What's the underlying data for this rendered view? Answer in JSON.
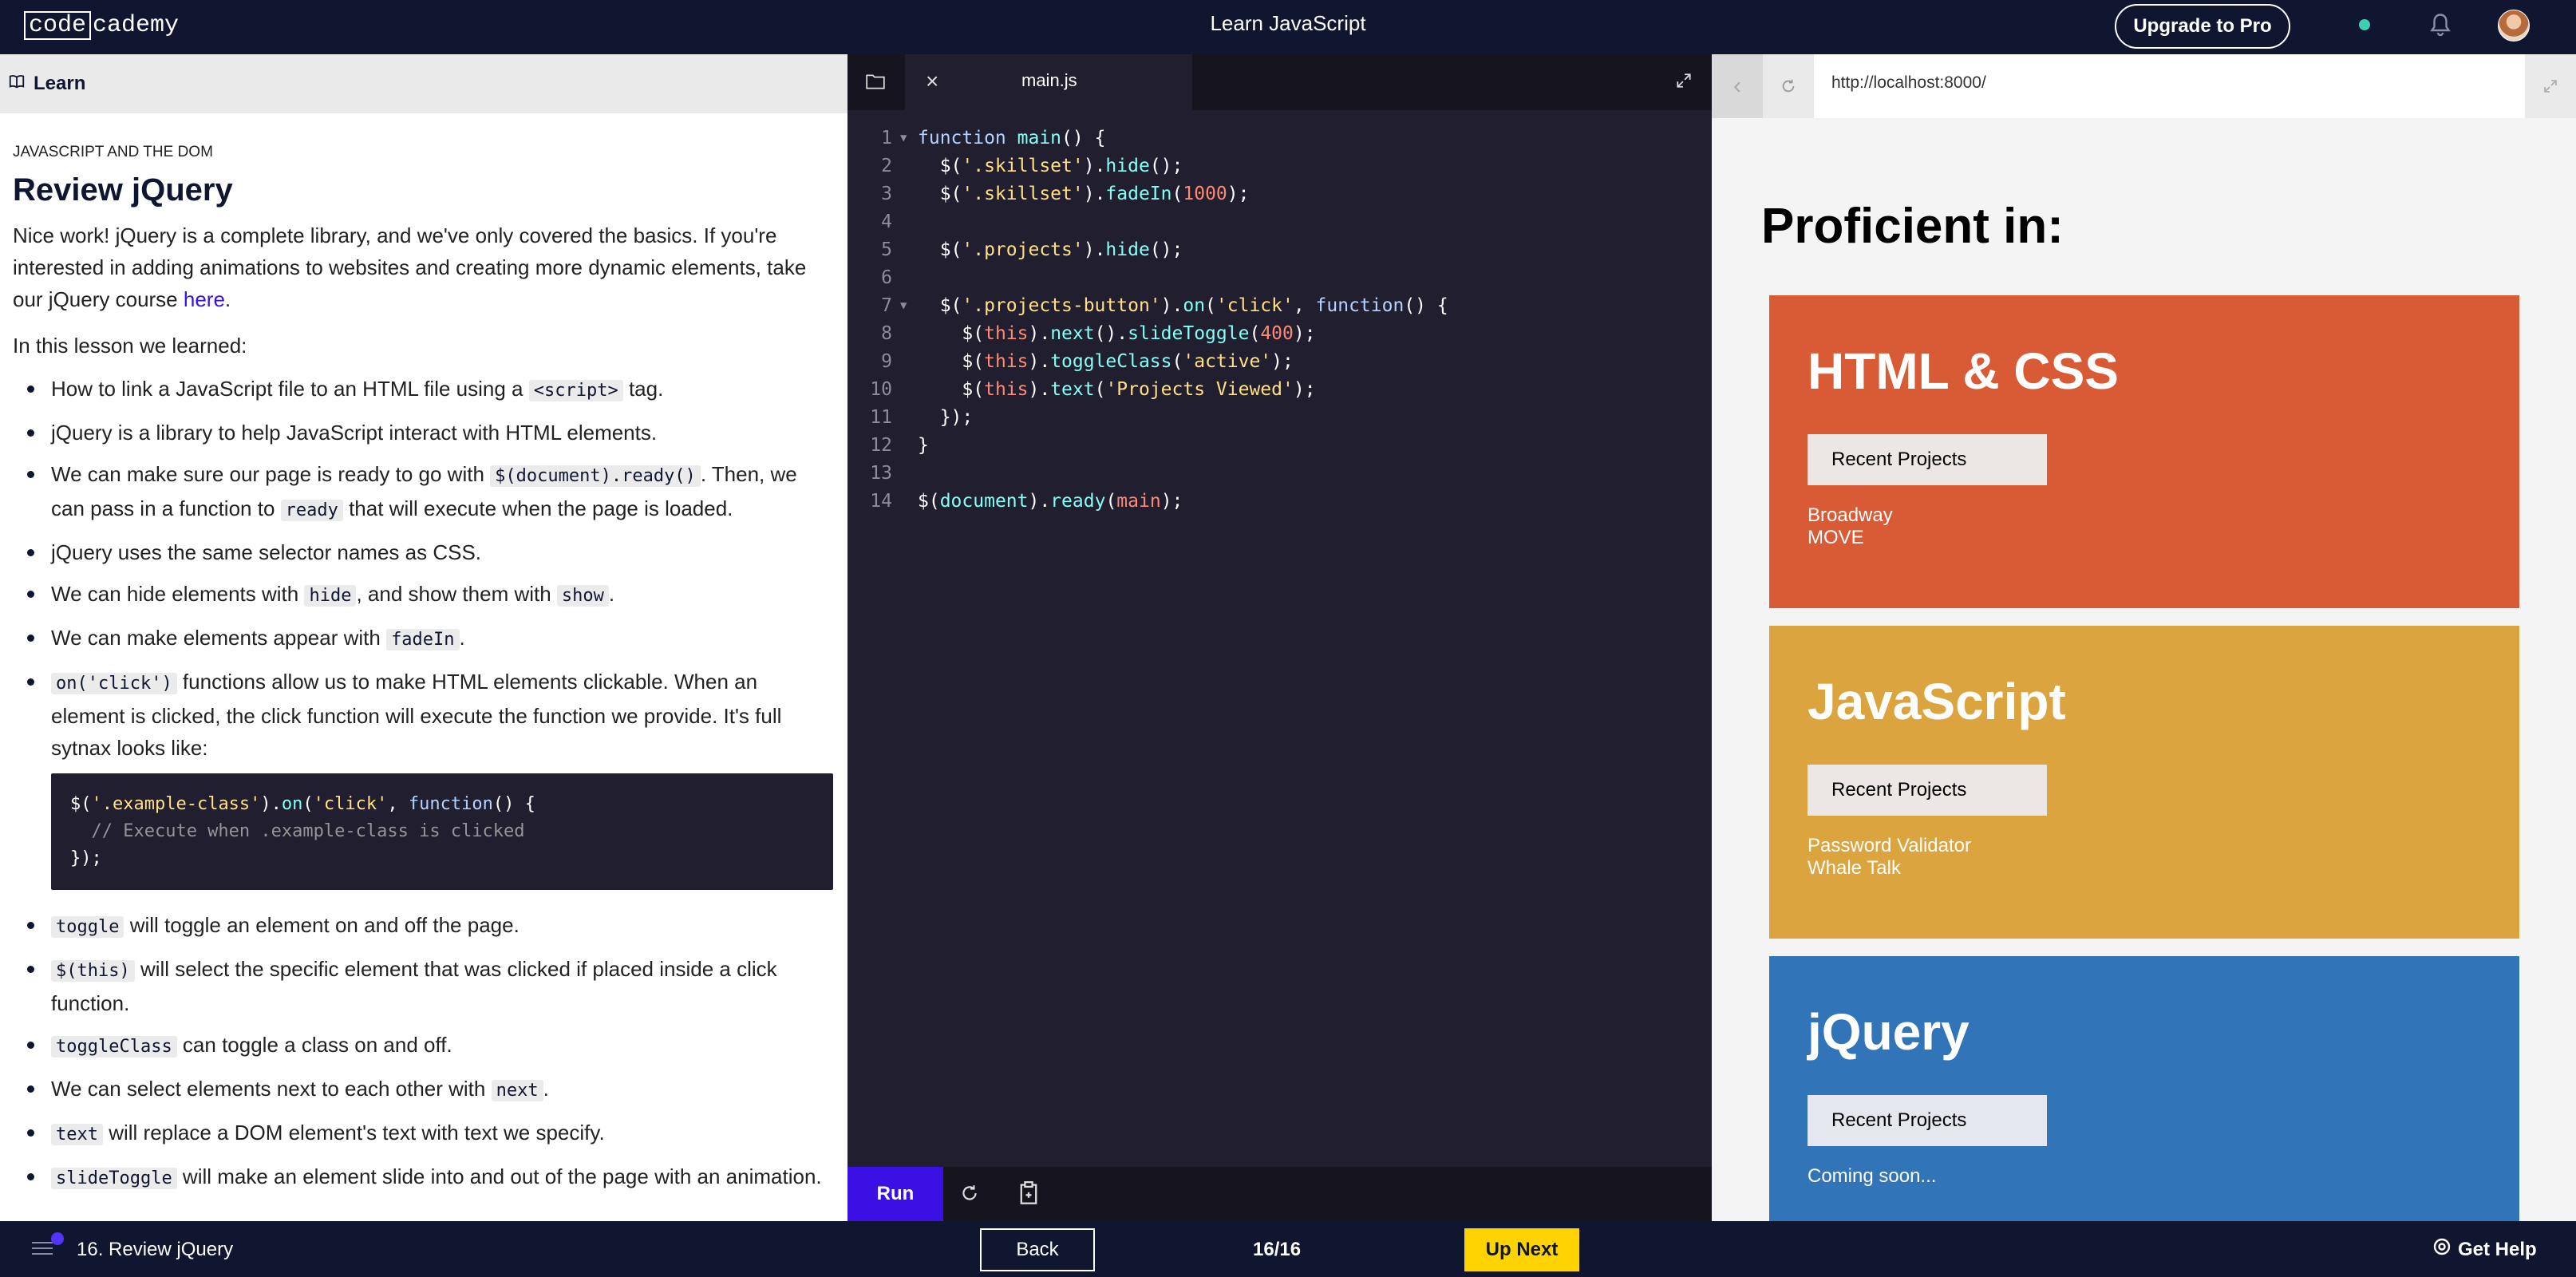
{
  "topbar": {
    "logo_box": "code",
    "logo_rest": "cademy",
    "title": "Learn JavaScript",
    "upgrade_label": "Upgrade to Pro",
    "status_color": "#3ecfb2"
  },
  "learn": {
    "header_label": "Learn",
    "overline": "JAVASCRIPT AND THE DOM",
    "title": "Review jQuery",
    "intro_1": "Nice work! jQuery is a complete library, and we've only covered the basics. If you're interested in adding animations to websites and creating more dynamic elements, take our jQuery course ",
    "intro_link": "here",
    "intro_end": ".",
    "learned": "In this lesson we learned:",
    "bullets": [
      {
        "pre": "How to link a JavaScript file to an HTML file using a ",
        "code": "<script>",
        "post": " tag."
      },
      {
        "pre": "jQuery is a library to help JavaScript interact with HTML elements.",
        "code": "",
        "post": ""
      },
      {
        "pre": "We can make sure our page is ready to go with ",
        "code": "$(document).ready()",
        "post": ". Then, we can pass in a function to ",
        "code2": "ready",
        "post2": " that will execute when the page is loaded."
      },
      {
        "pre": "jQuery uses the same selector names as CSS.",
        "code": "",
        "post": ""
      },
      {
        "pre": "We can hide elements with ",
        "code": "hide",
        "post": ", and show them with ",
        "code2": "show",
        "post2": "."
      },
      {
        "pre": "We can make elements appear with ",
        "code": "fadeIn",
        "post": "."
      },
      {
        "pre": "",
        "code": "on('click')",
        "post": " functions allow us to make HTML elements clickable. When an element is clicked, the click function will execute the function we provide. It's full sytnax looks like:"
      },
      {
        "pre": "",
        "code": "toggle",
        "post": " will toggle an element on and off the page."
      },
      {
        "pre": "",
        "code": "$(this)",
        "post": " will select the specific element that was clicked if placed inside a click function."
      },
      {
        "pre": "",
        "code": "toggleClass",
        "post": " can toggle a class on and off."
      },
      {
        "pre": "We can select elements next to each other with ",
        "code": "next",
        "post": "."
      },
      {
        "pre": "",
        "code": "text",
        "post": " will replace a DOM element's text with text we specify."
      },
      {
        "pre": "",
        "code": "slideToggle",
        "post": " will make an element slide into and out of the page with an animation."
      }
    ],
    "example_code": {
      "l1_a": "$(",
      "l1_b": "'.example-class'",
      "l1_c": ").",
      "l1_d": "on",
      "l1_e": "(",
      "l1_f": "'click'",
      "l1_g": ", ",
      "l1_h": "function",
      "l1_i": "() {",
      "l2": "  // Execute when .example-class is clicked",
      "l3": "});"
    }
  },
  "editor": {
    "tab_name": "main.js",
    "lines": [
      {
        "n": "1",
        "fold": true
      },
      {
        "n": "2",
        "fold": false
      },
      {
        "n": "3",
        "fold": false
      },
      {
        "n": "4",
        "fold": false
      },
      {
        "n": "5",
        "fold": false
      },
      {
        "n": "6",
        "fold": false
      },
      {
        "n": "7",
        "fold": true
      },
      {
        "n": "8",
        "fold": false
      },
      {
        "n": "9",
        "fold": false
      },
      {
        "n": "10",
        "fold": false
      },
      {
        "n": "11",
        "fold": false
      },
      {
        "n": "12",
        "fold": false
      },
      {
        "n": "13",
        "fold": false
      },
      {
        "n": "14",
        "fold": false
      }
    ],
    "run_label": "Run"
  },
  "browser": {
    "url": "http://localhost:8000/",
    "heading": "Proficient in:",
    "skills": [
      {
        "title": "HTML & CSS",
        "button": "Recent Projects",
        "projects": [
          "Broadway",
          "MOVE"
        ],
        "color": "#d95b35"
      },
      {
        "title": "JavaScript",
        "button": "Recent Projects",
        "projects": [
          "Password Validator",
          "Whale Talk"
        ],
        "color": "#dca43e"
      },
      {
        "title": "jQuery",
        "button": "Recent Projects",
        "projects": [
          "Coming soon..."
        ],
        "color": "#3274b8"
      }
    ]
  },
  "bottombar": {
    "lesson": "16. Review jQuery",
    "back_label": "Back",
    "progress": "16/16",
    "next_label": "Up Next",
    "help_label": "Get Help"
  }
}
